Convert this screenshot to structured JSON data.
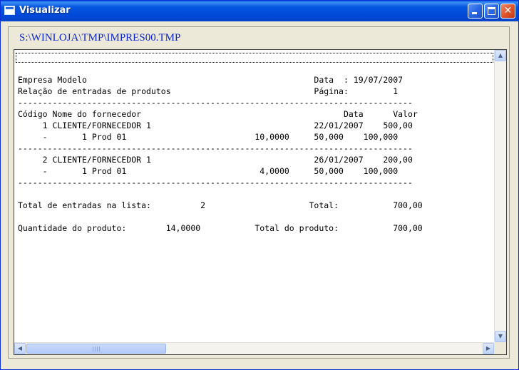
{
  "window": {
    "title": "Visualizar",
    "minimize_glyph": "",
    "close_glyph": "✕"
  },
  "path_label": "S:\\WINLOJA\\TMP\\IMPRES00.TMP",
  "report": {
    "lines": [
      "Empresa Modelo                                              Data  : 19/07/2007",
      "Relação de entradas de produtos                             Página:         1",
      "--------------------------------------------------------------------------------",
      "Código Nome do fornecedor                                         Data      Valor",
      "     1 CLIENTE/FORNECEDOR 1                                 22/01/2007    500,00",
      "     -       1 Prod 01                          10,0000     50,000    100,000",
      "--------------------------------------------------------------------------------",
      "     2 CLIENTE/FORNECEDOR 1                                 26/01/2007    200,00",
      "     -       1 Prod 01                           4,0000     50,000    100,000",
      "--------------------------------------------------------------------------------",
      "",
      "Total de entradas na lista:          2                     Total:           700,00",
      "",
      "Quantidade do produto:        14,0000           Total do produto:           700,00"
    ]
  },
  "scrollbar": {
    "up_arrow": "▲",
    "down_arrow": "▼",
    "left_arrow": "◀",
    "right_arrow": "▶"
  },
  "colors": {
    "titlebar": "#0054e3",
    "path_text": "#0b24d6",
    "window_bg": "#ece9d8"
  }
}
